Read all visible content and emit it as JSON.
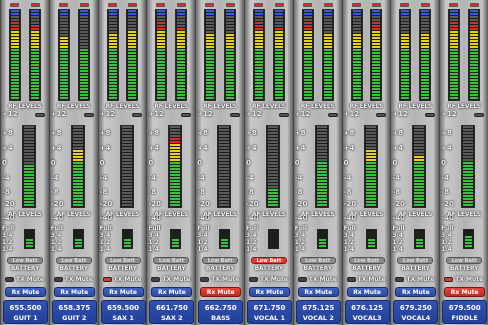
{
  "labels": {
    "rf_levels": "RF LEVELS",
    "af_levels": "AF LEVELS",
    "battery": "BATTERY",
    "low_batt": "Low Batt",
    "tx_mute": "TX Mute",
    "rx_mute": "Rx Mute"
  },
  "af_scale": [
    "+12",
    "+8",
    "+4",
    "0",
    "-4",
    "-8",
    "-20",
    "-40"
  ],
  "battery_scale": [
    "Full",
    "3/4",
    "1/2",
    "1/4"
  ],
  "colors": {
    "seg_green": "#3fbf3f",
    "seg_yellow": "#e8d020",
    "seg_red": "#e02b20",
    "seg_blue": "#2f5fd8",
    "seg_off": "#5a5a5a",
    "freq_bg": "#2b4aa0",
    "alert_red": "#e23a2f"
  },
  "channels": [
    {
      "freq": "655.500",
      "name": "GUIT 1",
      "rf_l": 0.85,
      "rf_r": 0.82,
      "af": 0.5,
      "batt": 0.45,
      "low_batt": false,
      "tx_mute": false,
      "rx_mute": false
    },
    {
      "freq": "658.375",
      "name": "GUIT 2",
      "rf_l": 0.7,
      "rf_r": 0.55,
      "af": 0.7,
      "batt": 0.45,
      "low_batt": false,
      "tx_mute": false,
      "rx_mute": false
    },
    {
      "freq": "659.500",
      "name": "SAX 1",
      "rf_l": 0.72,
      "rf_r": 0.75,
      "af": 0.0,
      "batt": 0.45,
      "low_batt": false,
      "tx_mute": true,
      "rx_mute": false
    },
    {
      "freq": "661.750",
      "name": "SAX 2",
      "rf_l": 0.85,
      "rf_r": 0.78,
      "af": 0.85,
      "batt": 0.45,
      "low_batt": false,
      "tx_mute": false,
      "rx_mute": false
    },
    {
      "freq": "662.750",
      "name": "BASS",
      "rf_l": 0.72,
      "rf_r": 0.72,
      "af": 0.0,
      "batt": 0.45,
      "low_batt": false,
      "tx_mute": false,
      "rx_mute": true
    },
    {
      "freq": "671.750",
      "name": "VOCAL 1",
      "rf_l": 0.85,
      "rf_r": 0.8,
      "af": 0.22,
      "batt": 0.0,
      "low_batt": true,
      "tx_mute": false,
      "rx_mute": false
    },
    {
      "freq": "675.125",
      "name": "VOCAL 2",
      "rf_l": 0.85,
      "rf_r": 0.72,
      "af": 0.55,
      "batt": 0.45,
      "low_batt": false,
      "tx_mute": false,
      "rx_mute": false
    },
    {
      "freq": "676.125",
      "name": "VOCAL3",
      "rf_l": 0.72,
      "rf_r": 0.85,
      "af": 0.68,
      "batt": 0.45,
      "low_batt": false,
      "tx_mute": false,
      "rx_mute": false
    },
    {
      "freq": "679.250",
      "name": "VOCAL4",
      "rf_l": 0.72,
      "rf_r": 0.72,
      "af": 0.6,
      "batt": 0.45,
      "low_batt": false,
      "tx_mute": false,
      "rx_mute": false
    },
    {
      "freq": "679.500",
      "name": "FIDDLE",
      "rf_l": 0.85,
      "rf_r": 0.85,
      "af": 0.55,
      "batt": 0.55,
      "low_batt": false,
      "tx_mute": true,
      "rx_mute": true
    }
  ]
}
